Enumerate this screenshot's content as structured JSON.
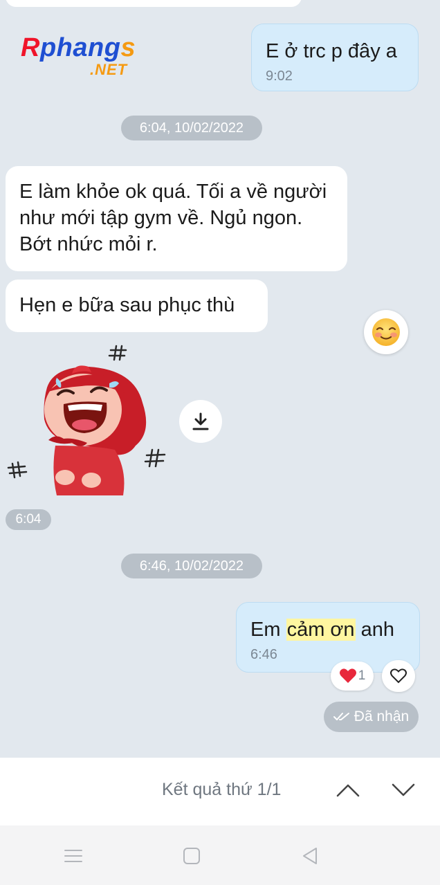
{
  "watermark": {
    "brand_first": "R",
    "brand_mid": "phang",
    "brand_last": "s",
    "brand_suffix": ".NET"
  },
  "messages": [
    {
      "id": "m1",
      "direction": "out",
      "text": "E ở trc p đây a",
      "time": "9:02"
    },
    {
      "id": "m2",
      "direction": "in",
      "text": "E làm khỏe ok quá. Tối a về người như mới tập gym về. Ngủ ngon. Bớt nhức mỏi r."
    },
    {
      "id": "m3",
      "direction": "in",
      "text": "Hẹn e bữa sau phục thù"
    },
    {
      "id": "m5",
      "direction": "out",
      "text_before": "Em ",
      "text_highlight": "cảm ơn",
      "text_after": " anh",
      "time": "6:46"
    }
  ],
  "separators": {
    "first": "6:04, 10/02/2022",
    "second": "6:46, 10/02/2022"
  },
  "sticker_time": "6:04",
  "reaction": {
    "icon": "heart-icon",
    "count": "1"
  },
  "status": {
    "label": "Đã nhận",
    "icon": "double-check-icon"
  },
  "search": {
    "result_text": "Kết quả thứ 1/1"
  },
  "colors": {
    "chat_bg": "#e2e8ee",
    "outgoing_bubble": "#d6ecfb",
    "highlight_border": "#1b84e8",
    "search_highlight": "#fff6a0",
    "heart": "#e8283c"
  }
}
